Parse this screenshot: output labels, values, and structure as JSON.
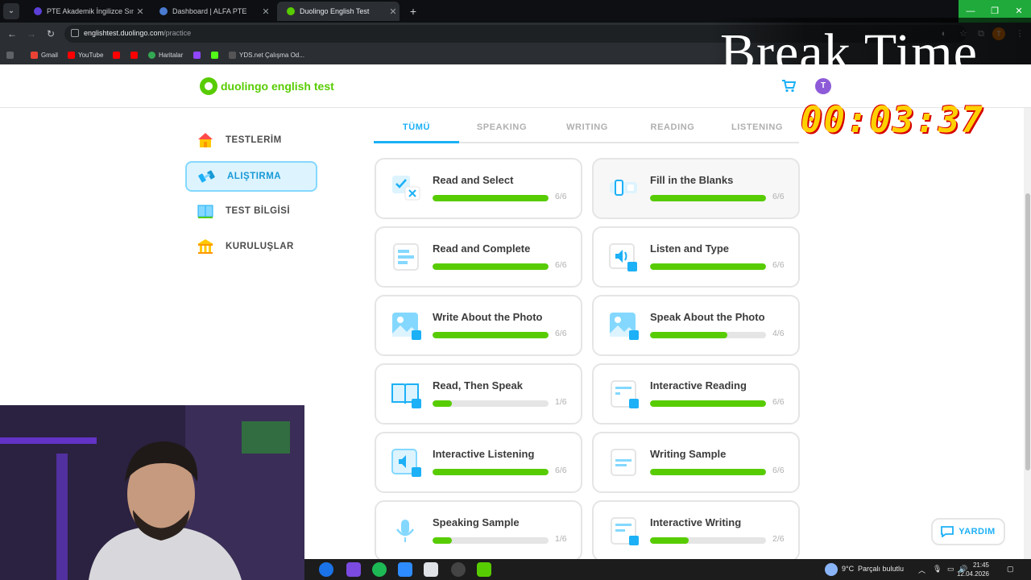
{
  "browser": {
    "tabs": [
      {
        "title": "PTE Akademik İngilizce Sınavı |",
        "favicon_color": "#5b3fd6"
      },
      {
        "title": "Dashboard | ALFA PTE",
        "favicon_color": "#4a7bd0"
      },
      {
        "title": "Duolingo English Test",
        "favicon_color": "#58cc02"
      }
    ],
    "url_host": "englishtest.duolingo.com",
    "url_path": "/practice",
    "profile_initial": "T",
    "bookmarks": [
      {
        "label": "Gmail",
        "color": "#ea4335"
      },
      {
        "label": "YouTube",
        "color": "#ff0000"
      },
      {
        "label": "",
        "color": "#ff0000"
      },
      {
        "label": "",
        "color": "#ff0000"
      },
      {
        "label": "Haritalar",
        "color": "#34a853"
      },
      {
        "label": "",
        "color": "#9146ff"
      },
      {
        "label": "",
        "color": "#53fc18"
      },
      {
        "label": "YDS.net Çalışma Od...",
        "color": "#555555"
      }
    ]
  },
  "overlay": {
    "break_text": "Break Time",
    "timer": "00:03:37"
  },
  "header": {
    "logo_text": "duolingo english test",
    "avatar_initial": "T"
  },
  "sidebar": {
    "items": [
      {
        "label": "TESTLERİM",
        "icon": "home-icon",
        "active": false
      },
      {
        "label": "ALIŞTIRMA",
        "icon": "dumbbell-icon",
        "active": true
      },
      {
        "label": "TEST BİLGİSİ",
        "icon": "book-icon",
        "active": false
      },
      {
        "label": "KURULUŞLAR",
        "icon": "institution-icon",
        "active": false
      }
    ]
  },
  "categories": {
    "tabs": [
      "TÜMÜ",
      "SPEAKING",
      "WRITING",
      "READING",
      "LISTENING"
    ],
    "active_index": 0
  },
  "practice": {
    "cards": [
      {
        "title": "Read and Select",
        "count": "6/6",
        "progress": 1.0,
        "icon": "read-select-icon"
      },
      {
        "title": "Fill in the Blanks",
        "count": "6/6",
        "progress": 1.0,
        "icon": "fill-blanks-icon"
      },
      {
        "title": "Read and Complete",
        "count": "6/6",
        "progress": 1.0,
        "icon": "read-complete-icon"
      },
      {
        "title": "Listen and Type",
        "count": "6/6",
        "progress": 1.0,
        "icon": "listen-type-icon"
      },
      {
        "title": "Write About the Photo",
        "count": "6/6",
        "progress": 1.0,
        "icon": "write-photo-icon"
      },
      {
        "title": "Speak About the Photo",
        "count": "4/6",
        "progress": 0.667,
        "icon": "speak-photo-icon"
      },
      {
        "title": "Read, Then Speak",
        "count": "1/6",
        "progress": 0.167,
        "icon": "read-speak-icon"
      },
      {
        "title": "Interactive Reading",
        "count": "6/6",
        "progress": 1.0,
        "icon": "interactive-reading-icon"
      },
      {
        "title": "Interactive Listening",
        "count": "6/6",
        "progress": 1.0,
        "icon": "interactive-listening-icon"
      },
      {
        "title": "Writing Sample",
        "count": "6/6",
        "progress": 1.0,
        "icon": "writing-sample-icon"
      },
      {
        "title": "Speaking Sample",
        "count": "1/6",
        "progress": 0.167,
        "icon": "speaking-sample-icon"
      },
      {
        "title": "Interactive Writing",
        "count": "2/6",
        "progress": 0.333,
        "icon": "interactive-writing-icon"
      }
    ]
  },
  "help": {
    "label": "YARDIM"
  },
  "taskbar": {
    "weather": "9°C",
    "weather_desc": "Parçalı bulutlu",
    "time": "21:45",
    "date": "12.04.2026"
  }
}
